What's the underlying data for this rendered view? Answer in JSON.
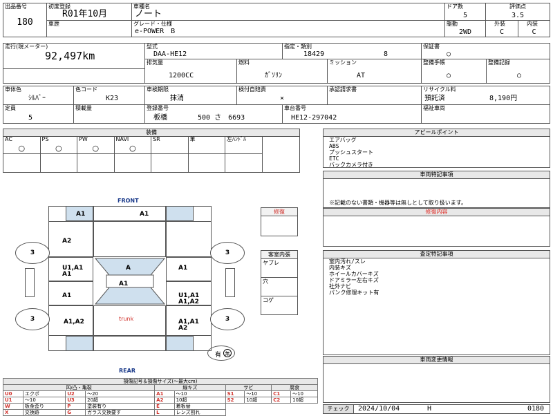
{
  "header": {
    "lot_label": "出品番号",
    "lot_value": "180",
    "first_reg_label": "初度登録",
    "first_reg_value": "R01年10月",
    "history_label": "車歴",
    "model_name_label": "車種名",
    "model_name_value": "ノート",
    "grade_label": "グレード・仕様",
    "grade_value": "e-POWER　B",
    "doors_label": "ドア数",
    "doors_value": "5",
    "drive_label": "駆動",
    "drive_value": "2WD",
    "score_label": "評価点",
    "score_value": "3.5",
    "exterior_label": "外装",
    "exterior_value": "C",
    "interior_label": "内装",
    "interior_value": "C"
  },
  "specs": {
    "mileage_label": "走行(現メーター)",
    "mileage_value": "92,497km",
    "type_label": "型式",
    "type_value": "DAA-HE12",
    "designation_label": "指定・類別",
    "designation_value": "18429",
    "category_value": "8",
    "warranty_label": "保証書",
    "warranty_value": "○",
    "displacement_label": "排気量",
    "displacement_value": "1200CC",
    "fuel_label": "燃料",
    "fuel_value": "ｶﾞｿﾘﾝ",
    "mission_label": "ミッション",
    "mission_value": "AT",
    "manual_label": "整備手帳",
    "manual_value": "○",
    "record_label": "整備記録",
    "record_value": "○",
    "color_label": "車体色",
    "color_value": "ｼﾙﾊﾞｰ",
    "color_code_label": "色コード",
    "color_code_value": "K23",
    "inspection_label": "車検期限",
    "inspection_value": "抹消",
    "self_check_label": "検付自賠責",
    "self_check_value": "×",
    "claim_label": "承認請求書",
    "recycle_label": "リサイクル料",
    "recycle_status": "預託済",
    "recycle_value": "8,190円",
    "capacity_label": "定員",
    "capacity_value": "5",
    "load_label": "積載量",
    "plate_label": "登録番号",
    "plate_region": "板橋",
    "plate_number": "500 さ　6693",
    "chassis_label": "車台番号",
    "chassis_value": "HE12-297042",
    "welfare_label": "福祉車両"
  },
  "equipment": {
    "title": "装備",
    "cols": [
      {
        "label": "AC",
        "value": "○"
      },
      {
        "label": "PS",
        "value": "○"
      },
      {
        "label": "PW",
        "value": "○"
      },
      {
        "label": "NAVI",
        "value": "○"
      },
      {
        "label": "SR",
        "value": ""
      },
      {
        "label": "革",
        "value": ""
      },
      {
        "label": "左ﾊﾝﾄﾞﾙ",
        "value": ""
      }
    ]
  },
  "appeal": {
    "title": "アピールポイント",
    "text": "エアバッグ\nABS\nプッシュスタート\nETC\nバックカメラ付き"
  },
  "special_notes": {
    "title": "車両特記事項",
    "footnote": "※記載のない書類・機器等は無しとして取り扱います。"
  },
  "repair": {
    "title": "修復内容"
  },
  "inspection_notes": {
    "title": "査定特記事項",
    "text": "室内汚れ/スレ\n内装キズ\nホイールカバーキズ\nドアミラー左右キズ\n社外ナビ\nパンク修理キット有"
  },
  "change_info": {
    "title": "車両変更情報"
  },
  "diagram": {
    "front": "FRONT",
    "rear": "REAR",
    "trunk": "trunk",
    "repair_box": "修復",
    "cabin_title": "客室内張",
    "cabin_items": [
      "ヤブレ",
      "穴",
      "コゲ"
    ],
    "tires": [
      "3",
      "3",
      "3",
      "3"
    ],
    "marks": {
      "front_left": "A1",
      "front_right": "A1",
      "hood_left": "A2",
      "left_front_door": "U1,A1\nA1",
      "windshield": "A",
      "right_front_door": "A1",
      "roof": "A1",
      "left_rear_door": "A1",
      "right_rear_door": "U1,A1\nA1,A2",
      "left_rear": "A1,A2",
      "right_rear": "A1,A1\nA2"
    },
    "badge": "有",
    "badge_inner": "無"
  },
  "legend": {
    "title": "損傷記号＆損傷サイズ(～最大cm)",
    "groups": [
      "凹/凸・亀裂",
      "線キズ",
      "サビ",
      "腐食"
    ],
    "row1": [
      [
        "U0",
        "エクボ"
      ],
      [
        "U2",
        "～20"
      ],
      [
        "A1",
        "～10"
      ],
      [
        "S1",
        "～10"
      ],
      [
        "C1",
        "～10"
      ]
    ],
    "row2": [
      [
        "U1",
        "～10"
      ],
      [
        "U3",
        "20超"
      ],
      [
        "A2",
        "10超"
      ],
      [
        "S2",
        "10超"
      ],
      [
        "C2",
        "10超"
      ]
    ],
    "row3": [
      [
        "W",
        "板金歪り"
      ],
      [
        "P",
        "塗装有り"
      ],
      [
        "E",
        "着板替"
      ]
    ],
    "row4": [
      [
        "X",
        "交換跡"
      ],
      [
        "G",
        "ガラス交換要す"
      ],
      [
        "L",
        "レンズ割れ"
      ]
    ]
  },
  "footer": {
    "check_label": "チェック",
    "date": "2024/10/04",
    "code": "H",
    "number": "0180"
  }
}
